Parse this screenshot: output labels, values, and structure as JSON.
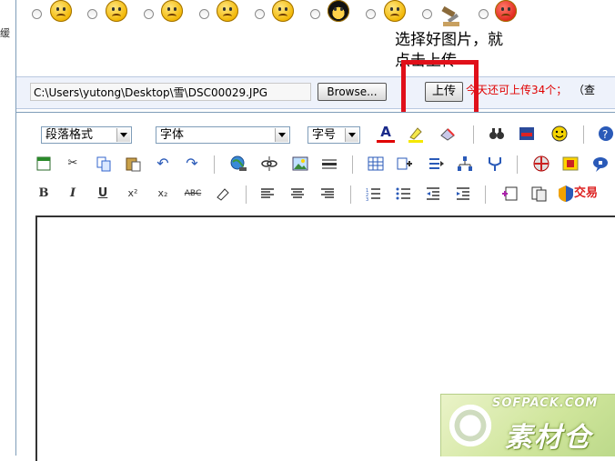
{
  "sidebar_fragment": "缓",
  "annotation": {
    "line1": "选择好图片，就",
    "line2": "点击上传"
  },
  "emoticons": [
    {
      "name": "question-face-icon"
    },
    {
      "name": "angry-face-icon"
    },
    {
      "name": "crying-face-icon"
    },
    {
      "name": "shocked-face-icon"
    },
    {
      "name": "wink-face-icon"
    },
    {
      "name": "blackface-icon"
    },
    {
      "name": "sad-face-icon"
    },
    {
      "name": "tools-icon"
    },
    {
      "name": "red-angry-face-icon"
    }
  ],
  "upload": {
    "file_path": "C:\\Users\\yutong\\Desktop\\雪\\DSC00029.JPG",
    "browse_label": "Browse...",
    "upload_label": "上传",
    "quota_text": "今天还可上传34个；",
    "quota_extra": "（查",
    "highlight_color": "#e0101a"
  },
  "toolbar": {
    "paragraph_format": "段落格式",
    "font": "字体",
    "font_size": "字号",
    "bold": "B",
    "italic": "I",
    "underline": "U",
    "superscript": "x²",
    "subscript": "x₂",
    "strike": "ABC",
    "trade_label": "交易"
  },
  "watermark": {
    "site": "SOFPACK.COM",
    "brand": "素材仓"
  }
}
